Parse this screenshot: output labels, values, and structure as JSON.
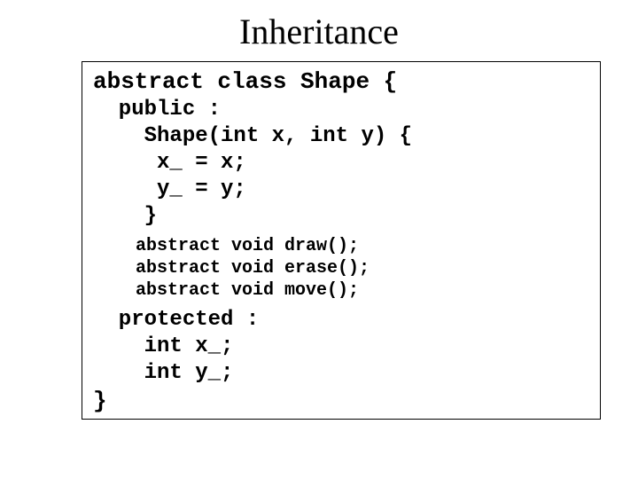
{
  "title": "Inheritance",
  "code": {
    "l1": "abstract class Shape {",
    "l2": "  public :",
    "l3": "    Shape(int x, int y) {",
    "l4": "     x_ = x;",
    "l5": "     y_ = y;",
    "l6": "    }",
    "l7": "    abstract void draw();",
    "l8": "    abstract void erase();",
    "l9": "    abstract void move();",
    "l10": "  protected :",
    "l11": "    int x_;",
    "l12": "    int y_;",
    "l13": "}"
  }
}
